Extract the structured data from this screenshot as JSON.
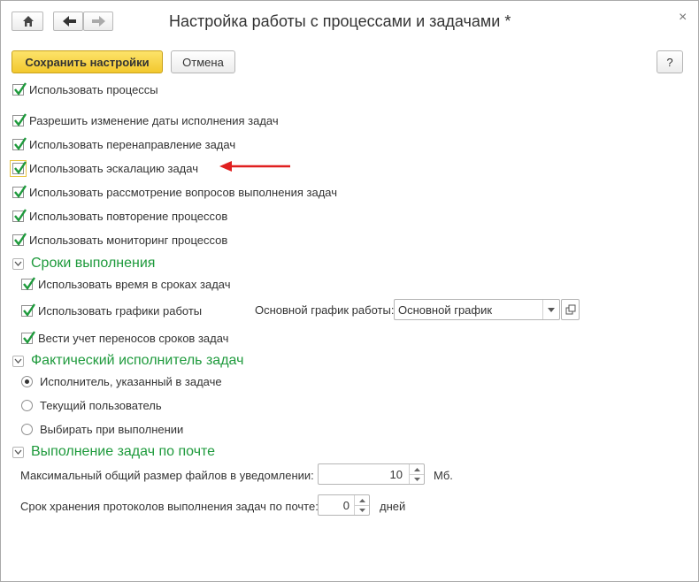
{
  "window": {
    "title": "Настройка работы с процессами и задачами *",
    "close_glyph": "×",
    "help_glyph": "?"
  },
  "toolbar": {
    "save_label": "Сохранить настройки",
    "cancel_label": "Отмена"
  },
  "main_options": [
    {
      "label": "Использовать процессы",
      "checked": true
    },
    {
      "label": "Разрешить изменение даты исполнения задач",
      "checked": true
    },
    {
      "label": "Использовать перенаправление задач",
      "checked": true
    },
    {
      "label": "Использовать эскалацию задач",
      "checked": true,
      "focused": true
    },
    {
      "label": "Использовать рассмотрение вопросов выполнения задач",
      "checked": true
    },
    {
      "label": "Использовать повторение процессов",
      "checked": true
    },
    {
      "label": "Использовать мониторинг процессов",
      "checked": true
    }
  ],
  "deadlines": {
    "title": "Сроки выполнения",
    "use_time_label": "Использовать время в сроках задач",
    "use_schedules_label": "Использовать графики работы",
    "schedule_label": "Основной график работы:",
    "schedule_value": "Основной график",
    "track_transfers_label": "Вести учет переносов сроков задач"
  },
  "executor": {
    "title": "Фактический исполнитель задач",
    "options": [
      {
        "label": "Исполнитель, указанный в задаче",
        "selected": true
      },
      {
        "label": "Текущий пользователь",
        "selected": false
      },
      {
        "label": "Выбирать при выполнении",
        "selected": false
      }
    ]
  },
  "email": {
    "title": "Выполнение задач по почте",
    "max_size_label": "Максимальный общий размер файлов в уведомлении:",
    "max_size_value": "10",
    "max_size_unit": "Мб.",
    "retention_label": "Срок хранения протоколов выполнения задач по почте:",
    "retention_value": "0",
    "retention_unit": "дней"
  },
  "colors": {
    "accent_green": "#1e9a3c",
    "arrow_red": "#e02020",
    "primary_button": "#f7d44a"
  },
  "icons": [
    "home-icon",
    "back-arrow-icon",
    "forward-arrow-icon",
    "close-icon",
    "help-icon",
    "chevron-down-icon",
    "checkmark-icon",
    "open-icon",
    "red-arrow-annotation"
  ]
}
